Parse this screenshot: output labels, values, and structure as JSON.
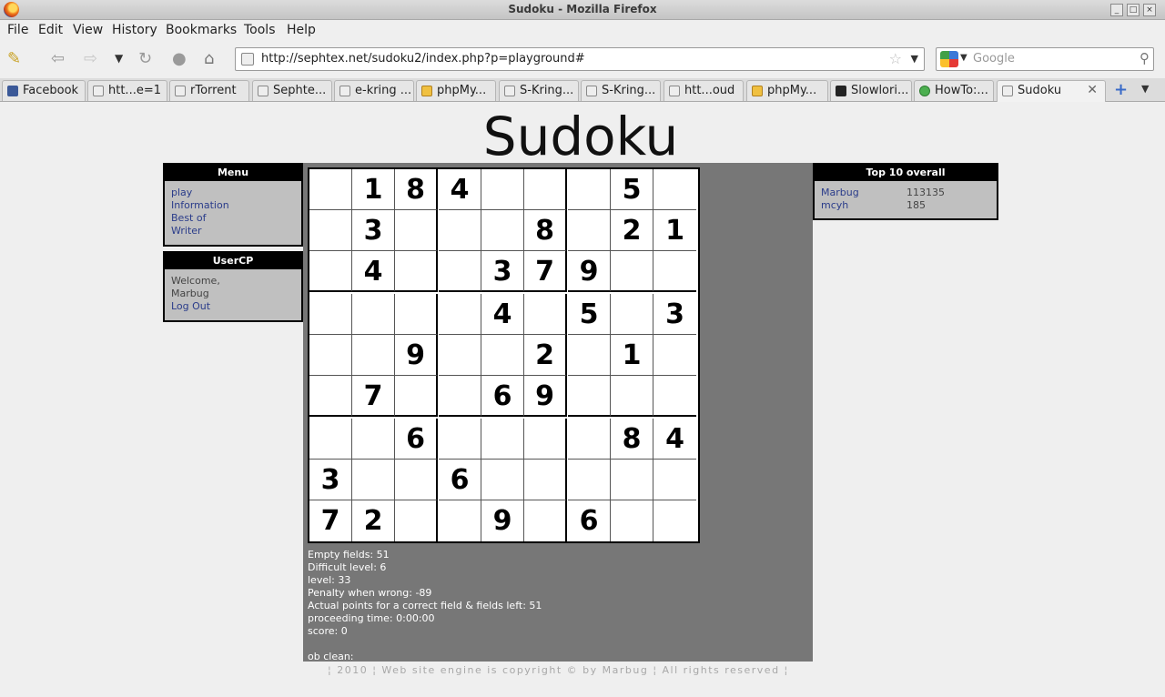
{
  "window": {
    "title": "Sudoku - Mozilla Firefox"
  },
  "menu": [
    "File",
    "Edit",
    "View",
    "History",
    "Bookmarks",
    "Tools",
    "Help"
  ],
  "nav": {
    "url": "http://sephtex.net/sudoku2/index.php?p=playground#",
    "search_placeholder": "Google"
  },
  "tabs": [
    {
      "label": "Facebook",
      "icon": "fb"
    },
    {
      "label": "htt...e=1",
      "icon": "page"
    },
    {
      "label": "rTorrent",
      "icon": "page"
    },
    {
      "label": "Sephte...",
      "icon": "page"
    },
    {
      "label": "e-kring ...",
      "icon": "page"
    },
    {
      "label": "phpMy...",
      "icon": "pma"
    },
    {
      "label": "S-Kring...",
      "icon": "page"
    },
    {
      "label": "S-Kring...",
      "icon": "page"
    },
    {
      "label": "htt...oud",
      "icon": "page"
    },
    {
      "label": "phpMy...",
      "icon": "pma"
    },
    {
      "label": "Slowlori...",
      "icon": "rs"
    },
    {
      "label": "HowTo:...",
      "icon": "how"
    },
    {
      "label": "Sudoku",
      "icon": "page",
      "active": true
    }
  ],
  "page": {
    "logo": "Sudoku",
    "menu_box": {
      "title": "Menu",
      "links": [
        "play",
        "Information",
        "Best of",
        "Writer"
      ]
    },
    "usercp_box": {
      "title": "UserCP",
      "welcome": "Welcome,",
      "user": "Marbug",
      "logout": "Log Out"
    },
    "top10": {
      "title": "Top 10 overall",
      "rows": [
        {
          "name": "Marbug",
          "score": "113135"
        },
        {
          "name": "mcyh",
          "score": "185"
        }
      ]
    },
    "grid": [
      [
        "",
        "1",
        "8",
        "4",
        "",
        "",
        "",
        "5",
        ""
      ],
      [
        "",
        "3",
        "",
        "",
        "",
        "8",
        "",
        "2",
        "1"
      ],
      [
        "",
        "4",
        "",
        "",
        "3",
        "7",
        "9",
        "",
        ""
      ],
      [
        "",
        "",
        "",
        "",
        "4",
        "",
        "5",
        "",
        "3"
      ],
      [
        "",
        "",
        "9",
        "",
        "",
        "2",
        "",
        "1",
        ""
      ],
      [
        "",
        "7",
        "",
        "",
        "6",
        "9",
        "",
        "",
        ""
      ],
      [
        "",
        "",
        "6",
        "",
        "",
        "",
        "",
        "8",
        "4"
      ],
      [
        "3",
        "",
        "",
        "6",
        "",
        "",
        "",
        "",
        ""
      ],
      [
        "7",
        "2",
        "",
        "",
        "9",
        "",
        "6",
        "",
        ""
      ]
    ],
    "stats": {
      "empty": "Empty fields: 51",
      "difficult": "Difficult level: 6",
      "level": "level: 33",
      "penalty": "Penalty when wrong: -89",
      "points": "Actual points for a correct field & fields left: 51",
      "time": "proceeding time: 0:00:00",
      "score": "score: 0",
      "clean": "ob clean:"
    },
    "footer": "¦ 2010 ¦ Web site engine is copyright © by Marbug ¦ All rights reserved ¦"
  }
}
